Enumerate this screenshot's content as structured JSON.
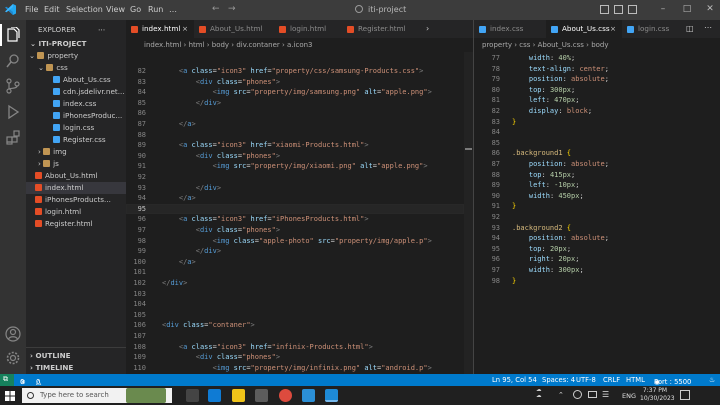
{
  "titlebar": {
    "menus": [
      "File",
      "Edit",
      "Selection",
      "View",
      "Go",
      "Run",
      "…"
    ],
    "window_title": "iti-project"
  },
  "sidebar": {
    "header": "EXPLORER",
    "project": "ITI-PROJECT",
    "items": [
      {
        "label": "property",
        "type": "folder-open",
        "indent": 1
      },
      {
        "label": "css",
        "type": "folder-open",
        "indent": 2
      },
      {
        "label": "About_Us.css",
        "type": "css",
        "indent": 3
      },
      {
        "label": "cdn.jsdelivr.net...",
        "type": "css",
        "indent": 3
      },
      {
        "label": "index.css",
        "type": "css",
        "indent": 3
      },
      {
        "label": "iPhonesProduc...",
        "type": "css",
        "indent": 3
      },
      {
        "label": "login.css",
        "type": "css",
        "indent": 3
      },
      {
        "label": "Register.css",
        "type": "css",
        "indent": 3
      },
      {
        "label": "img",
        "type": "folder",
        "indent": 2
      },
      {
        "label": "js",
        "type": "folder",
        "indent": 2
      },
      {
        "label": "About_Us.html",
        "type": "html",
        "indent": 1
      },
      {
        "label": "index.html",
        "type": "html",
        "indent": 1,
        "selected": true
      },
      {
        "label": "iPhonesProducts...",
        "type": "html",
        "indent": 1
      },
      {
        "label": "login.html",
        "type": "html",
        "indent": 1
      },
      {
        "label": "Register.html",
        "type": "html",
        "indent": 1
      }
    ],
    "outline": "OUTLINE",
    "timeline": "TIMELINE"
  },
  "left_editor": {
    "tabs": [
      {
        "label": "index.html",
        "type": "html",
        "active": true
      },
      {
        "label": "About_Us.html",
        "type": "html"
      },
      {
        "label": "login.html",
        "type": "html"
      },
      {
        "label": "Register.html",
        "type": "html"
      }
    ],
    "breadcrumb": "index.html  ›  html  ›  body  ›  div.contaner  ›  a.icon3",
    "line_numbers": [
      "82",
      "83",
      "84",
      "85",
      "86",
      "87",
      "88",
      "89",
      "90",
      "91",
      "92",
      "93",
      "94",
      "95",
      "96",
      "97",
      "98",
      "99",
      "100",
      "101",
      "102",
      "103",
      "104",
      "105",
      "106",
      "107",
      "108",
      "109",
      "110"
    ]
  },
  "right_editor": {
    "tabs": [
      {
        "label": "index.css",
        "type": "css"
      },
      {
        "label": "About_Us.css",
        "type": "css",
        "active": true
      },
      {
        "label": "login.css",
        "type": "css"
      }
    ],
    "breadcrumb": "property  ›  css  ›  About_Us.css  ›  body",
    "line_numbers": [
      "77",
      "78",
      "79",
      "80",
      "81",
      "82",
      "83",
      "84",
      "85",
      "86",
      "87",
      "88",
      "89",
      "90",
      "91",
      "92",
      "93",
      "94",
      "95",
      "96",
      "97",
      "98"
    ]
  },
  "statusbar": {
    "errors": "0",
    "warnings": "0",
    "position": "Ln 95, Col 54",
    "spaces": "Spaces: 4",
    "encoding": "UTF-8",
    "eol": "CRLF",
    "language": "HTML",
    "port": "Port : 5500"
  },
  "taskbar": {
    "search_placeholder": "Type here to search",
    "lang": "ENG",
    "time": "7:37 PM",
    "date": "10/30/2023"
  },
  "colors": {
    "accent": "#007acc",
    "html_icon": "#e44d26",
    "css_icon": "#42a5f5",
    "folder_icon": "#c09553"
  }
}
